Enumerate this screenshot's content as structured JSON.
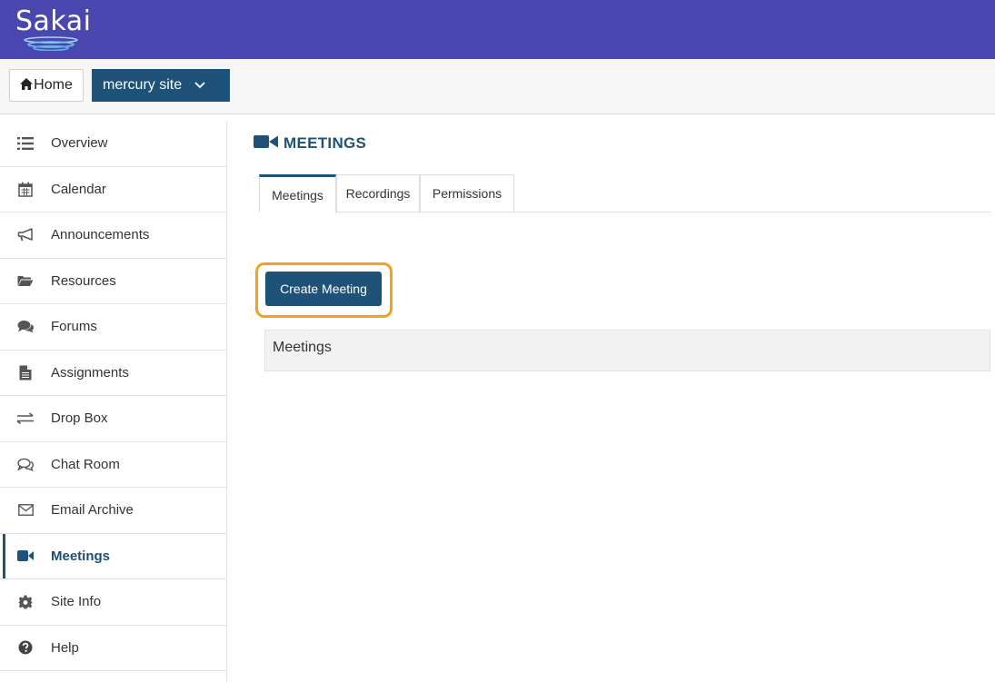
{
  "brand": {
    "logo_text": "Sakai",
    "banner_color": "#4a47b1"
  },
  "site_nav": {
    "home_label": "Home",
    "site_label": "mercury site"
  },
  "tool_menu": {
    "items": [
      {
        "label": "Overview",
        "icon": "list-icon"
      },
      {
        "label": "Calendar",
        "icon": "calendar-icon"
      },
      {
        "label": "Announcements",
        "icon": "megaphone-icon"
      },
      {
        "label": "Resources",
        "icon": "folder-icon"
      },
      {
        "label": "Forums",
        "icon": "comments-icon"
      },
      {
        "label": "Assignments",
        "icon": "file-icon"
      },
      {
        "label": "Drop Box",
        "icon": "exchange-icon"
      },
      {
        "label": "Chat Room",
        "icon": "chat-icon"
      },
      {
        "label": "Email Archive",
        "icon": "envelope-icon"
      },
      {
        "label": "Meetings",
        "icon": "video-camera-icon",
        "active": true
      },
      {
        "label": "Site Info",
        "icon": "gear-icon"
      },
      {
        "label": "Help",
        "icon": "question-icon"
      }
    ]
  },
  "main": {
    "title": "MEETINGS",
    "tabs": [
      {
        "label": "Meetings",
        "active": true
      },
      {
        "label": "Recordings"
      },
      {
        "label": "Permissions"
      }
    ],
    "create_button_label": "Create Meeting",
    "panel_heading": "Meetings"
  },
  "colors": {
    "accent": "#1e5279",
    "highlight": "#f5a11e"
  }
}
